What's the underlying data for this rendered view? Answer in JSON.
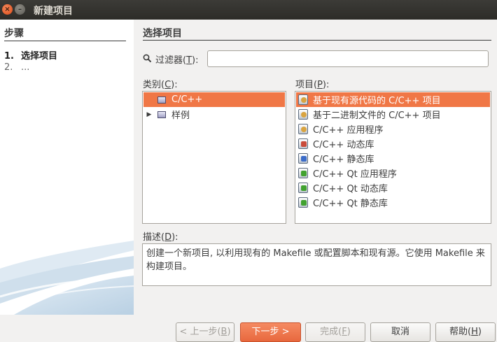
{
  "window": {
    "title": "新建项目",
    "close_glyph": "×",
    "minimize_glyph": "–"
  },
  "sidebar": {
    "title": "步骤",
    "steps": [
      {
        "num": "1.",
        "label": "选择项目"
      },
      {
        "num": "2.",
        "label": "..."
      }
    ]
  },
  "main": {
    "title": "选择项目",
    "filter": {
      "label_pre": "过滤器(",
      "label_key": "T",
      "label_post": "):",
      "value": "",
      "icon": "search-icon"
    },
    "categories": {
      "label_pre": "类别(",
      "label_key": "C",
      "label_post": "):",
      "items": [
        {
          "label": "C/C++",
          "selected": true,
          "expander": ""
        },
        {
          "label": "样例",
          "selected": false,
          "expander": "▶"
        }
      ]
    },
    "projects": {
      "label_pre": "项目(",
      "label_key": "P",
      "label_post": "):",
      "items": [
        {
          "label": "基于现有源代码的 C/C++ 项目",
          "icon": "import-project-icon",
          "selected": true
        },
        {
          "label": "基于二进制文件的 C/C++ 项目",
          "icon": "binary-project-icon",
          "selected": false
        },
        {
          "label": "C/C++ 应用程序",
          "icon": "application-icon",
          "selected": false
        },
        {
          "label": "C/C++ 动态库",
          "icon": "dynamic-library-icon",
          "selected": false
        },
        {
          "label": "C/C++ 静态库",
          "icon": "static-library-icon",
          "selected": false
        },
        {
          "label": "C/C++ Qt 应用程序",
          "icon": "qt-application-icon",
          "selected": false
        },
        {
          "label": "C/C++ Qt 动态库",
          "icon": "qt-dynamic-library-icon",
          "selected": false
        },
        {
          "label": "C/C++ Qt 静态库",
          "icon": "qt-static-library-icon",
          "selected": false
        }
      ]
    },
    "description": {
      "label_pre": "描述(",
      "label_key": "D",
      "label_post": "):",
      "text": "创建一个新项目, 以利用现有的 Makefile 或配置脚本和现有源。它使用 Makefile 来构建项目。"
    }
  },
  "buttons": {
    "back": {
      "pre": "< 上一步(",
      "key": "B",
      "post": ")",
      "enabled": false
    },
    "next": {
      "label": "下一步 >",
      "enabled": true
    },
    "finish": {
      "pre": "完成(",
      "key": "F",
      "post": ")",
      "enabled": false
    },
    "cancel": {
      "label": "取消",
      "enabled": true
    },
    "help": {
      "pre": "帮助(",
      "key": "H",
      "post": ")",
      "enabled": true
    }
  },
  "colors": {
    "selection": "#f07746",
    "titlebar": "#3c3b37",
    "accent": "#e8683e"
  }
}
